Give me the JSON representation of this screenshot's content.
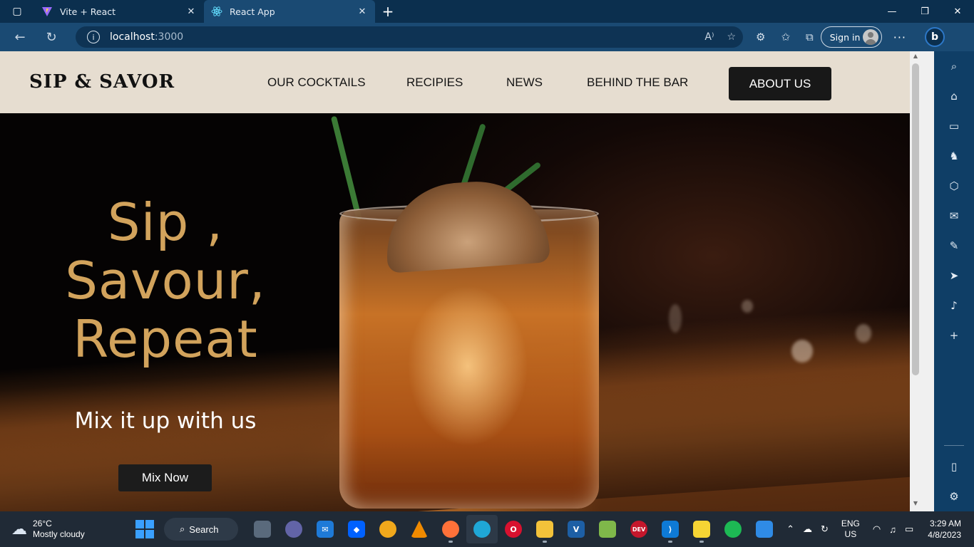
{
  "browser": {
    "tabs": [
      {
        "title": "Vite + React",
        "active": false
      },
      {
        "title": "React App",
        "active": true
      }
    ],
    "address": {
      "host": "localhost",
      "port": ":3000"
    },
    "sign_in": "Sign in"
  },
  "site": {
    "logo": "SIP & SAVOR",
    "nav": [
      "OUR COCKTAILS",
      "RECIPIES",
      "NEWS",
      "BEHIND THE BAR"
    ],
    "cta": "ABOUT US",
    "hero": {
      "title_line1": "Sip ,",
      "title_line2": "Savour,",
      "title_line3": "Repeat",
      "subtitle": "Mix it up with us",
      "button": "Mix Now"
    }
  },
  "colors": {
    "header_bg": "#e6ddd0",
    "hero_title": "#d2a35c",
    "button_bg": "#1c1c1c",
    "browser_frame": "#1a4a73"
  },
  "taskbar": {
    "weather": {
      "temp": "26°C",
      "condition": "Mostly cloudy"
    },
    "search": "Search",
    "lang": {
      "line1": "ENG",
      "line2": "US"
    },
    "clock": {
      "time": "3:29 AM",
      "date": "4/8/2023"
    }
  }
}
